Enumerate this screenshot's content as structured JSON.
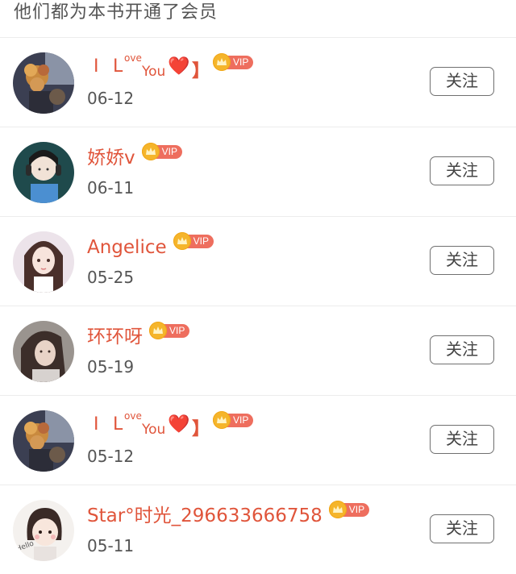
{
  "header": {
    "text": "他们都为本书开通了会员"
  },
  "badge": {
    "vip_label": "VIP"
  },
  "follow_label": "关注",
  "colors": {
    "name": "#e0553b",
    "vip_tag": "#ee6e5e",
    "crown": "#f5b52b"
  },
  "members": [
    {
      "name_parts": {
        "l1": "I",
        "l2": "L",
        "sup": "ove",
        "sub": "You",
        "heart": "❤️",
        "bracket": "】"
      },
      "date": "06-12",
      "avatar": "flower-bouquet-avatar"
    },
    {
      "name": "娇娇v",
      "date": "06-11",
      "avatar": "girl-headphones-avatar"
    },
    {
      "name": "Angelice",
      "date": "05-25",
      "avatar": "anime-girl-avatar"
    },
    {
      "name": "环环呀",
      "date": "05-19",
      "avatar": "girl-portrait-avatar"
    },
    {
      "name_parts": {
        "l1": "I",
        "l2": "L",
        "sup": "ove",
        "sub": "You",
        "heart": "❤️",
        "bracket": "】"
      },
      "date": "05-12",
      "avatar": "flower-bouquet-avatar"
    },
    {
      "name": "Star°时光_296633666758",
      "date": "05-11",
      "avatar": "cartoon-girl-hello-avatar"
    }
  ]
}
